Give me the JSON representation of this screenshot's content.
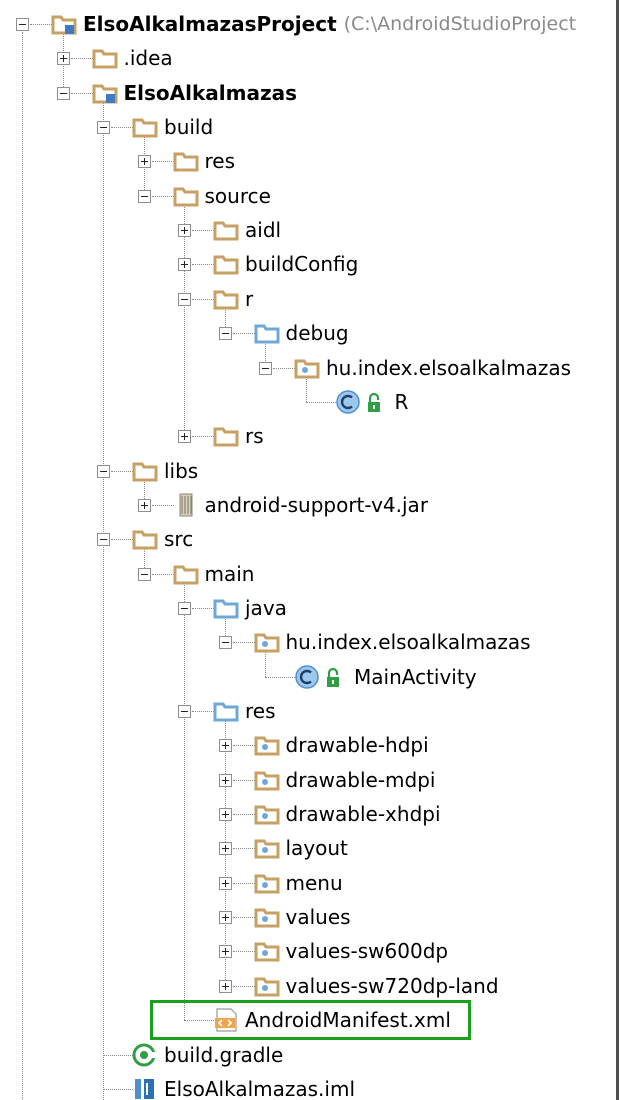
{
  "colors": {
    "folder": "#c7a064",
    "source_folder": "#6fa8d6",
    "highlight": "#19a11d",
    "hint_text": "#8a8a8a",
    "tree_lines": "#8a8a8a"
  },
  "project_tree": {
    "nodes": [
      {
        "id": "project-root",
        "label": "ElsoAlkalmazasProject",
        "hint": "(C:\\AndroidStudioProject",
        "bold": true,
        "depth": 0,
        "toggle": "expanded",
        "icon": "module-folder-icon"
      },
      {
        "id": "idea",
        "label": ".idea",
        "depth": 1,
        "toggle": "collapsed",
        "icon": "folder-icon"
      },
      {
        "id": "module",
        "label": "ElsoAlkalmazas",
        "bold": true,
        "depth": 1,
        "toggle": "expanded",
        "icon": "module-folder-icon"
      },
      {
        "id": "build",
        "label": "build",
        "depth": 2,
        "toggle": "expanded",
        "icon": "folder-icon"
      },
      {
        "id": "build-res",
        "label": "res",
        "depth": 3,
        "toggle": "collapsed",
        "icon": "folder-icon"
      },
      {
        "id": "build-source",
        "label": "source",
        "depth": 3,
        "toggle": "expanded",
        "icon": "folder-icon"
      },
      {
        "id": "aidl",
        "label": "aidl",
        "depth": 4,
        "toggle": "collapsed",
        "icon": "folder-icon"
      },
      {
        "id": "buildconfig",
        "label": "buildConfig",
        "depth": 4,
        "toggle": "collapsed",
        "icon": "folder-icon"
      },
      {
        "id": "r",
        "label": "r",
        "depth": 4,
        "toggle": "expanded",
        "icon": "folder-icon"
      },
      {
        "id": "debug",
        "label": "debug",
        "depth": 5,
        "toggle": "expanded",
        "icon": "source-folder-icon"
      },
      {
        "id": "r-package",
        "label": "hu.index.elsoalkalmazas",
        "depth": 6,
        "toggle": "expanded",
        "icon": "package-icon"
      },
      {
        "id": "r-class",
        "label": "R",
        "depth": 7,
        "toggle": "none",
        "icon": "class-icon",
        "icon_extra": "lock-icon"
      },
      {
        "id": "rs",
        "label": "rs",
        "depth": 4,
        "toggle": "collapsed",
        "icon": "folder-icon"
      },
      {
        "id": "libs",
        "label": "libs",
        "depth": 2,
        "toggle": "expanded",
        "icon": "folder-icon"
      },
      {
        "id": "support-jar",
        "label": "android-support-v4.jar",
        "depth": 3,
        "toggle": "collapsed",
        "icon": "jar-icon"
      },
      {
        "id": "src",
        "label": "src",
        "depth": 2,
        "toggle": "expanded",
        "icon": "folder-icon"
      },
      {
        "id": "main",
        "label": "main",
        "depth": 3,
        "toggle": "expanded",
        "icon": "folder-icon"
      },
      {
        "id": "java",
        "label": "java",
        "depth": 4,
        "toggle": "expanded",
        "icon": "source-folder-icon"
      },
      {
        "id": "java-package",
        "label": "hu.index.elsoalkalmazas",
        "depth": 5,
        "toggle": "expanded",
        "icon": "package-icon"
      },
      {
        "id": "main-activity",
        "label": "MainActivity",
        "depth": 6,
        "toggle": "none",
        "icon": "class-icon",
        "icon_extra": "lock-icon"
      },
      {
        "id": "main-res",
        "label": "res",
        "depth": 4,
        "toggle": "expanded",
        "icon": "source-folder-icon"
      },
      {
        "id": "drawable-hdpi",
        "label": "drawable-hdpi",
        "depth": 5,
        "toggle": "collapsed",
        "icon": "package-icon"
      },
      {
        "id": "drawable-mdpi",
        "label": "drawable-mdpi",
        "depth": 5,
        "toggle": "collapsed",
        "icon": "package-icon"
      },
      {
        "id": "drawable-xhdpi",
        "label": "drawable-xhdpi",
        "depth": 5,
        "toggle": "collapsed",
        "icon": "package-icon"
      },
      {
        "id": "layout",
        "label": "layout",
        "depth": 5,
        "toggle": "collapsed",
        "icon": "package-icon"
      },
      {
        "id": "menu",
        "label": "menu",
        "depth": 5,
        "toggle": "collapsed",
        "icon": "package-icon"
      },
      {
        "id": "values",
        "label": "values",
        "depth": 5,
        "toggle": "collapsed",
        "icon": "package-icon"
      },
      {
        "id": "values-sw600dp",
        "label": "values-sw600dp",
        "depth": 5,
        "toggle": "collapsed",
        "icon": "package-icon"
      },
      {
        "id": "values-sw720dp-land",
        "label": "values-sw720dp-land",
        "depth": 5,
        "toggle": "collapsed",
        "icon": "package-icon"
      },
      {
        "id": "android-manifest",
        "label": "AndroidManifest.xml",
        "depth": 4,
        "toggle": "none",
        "icon": "xml-file-icon",
        "highlighted": true
      },
      {
        "id": "build-gradle",
        "label": "build.gradle",
        "depth": 2,
        "toggle": "none",
        "icon": "gradle-icon"
      },
      {
        "id": "module-iml",
        "label": "ElsoAlkalmazas.iml",
        "depth": 2,
        "toggle": "none",
        "icon": "iml-file-icon"
      }
    ]
  }
}
